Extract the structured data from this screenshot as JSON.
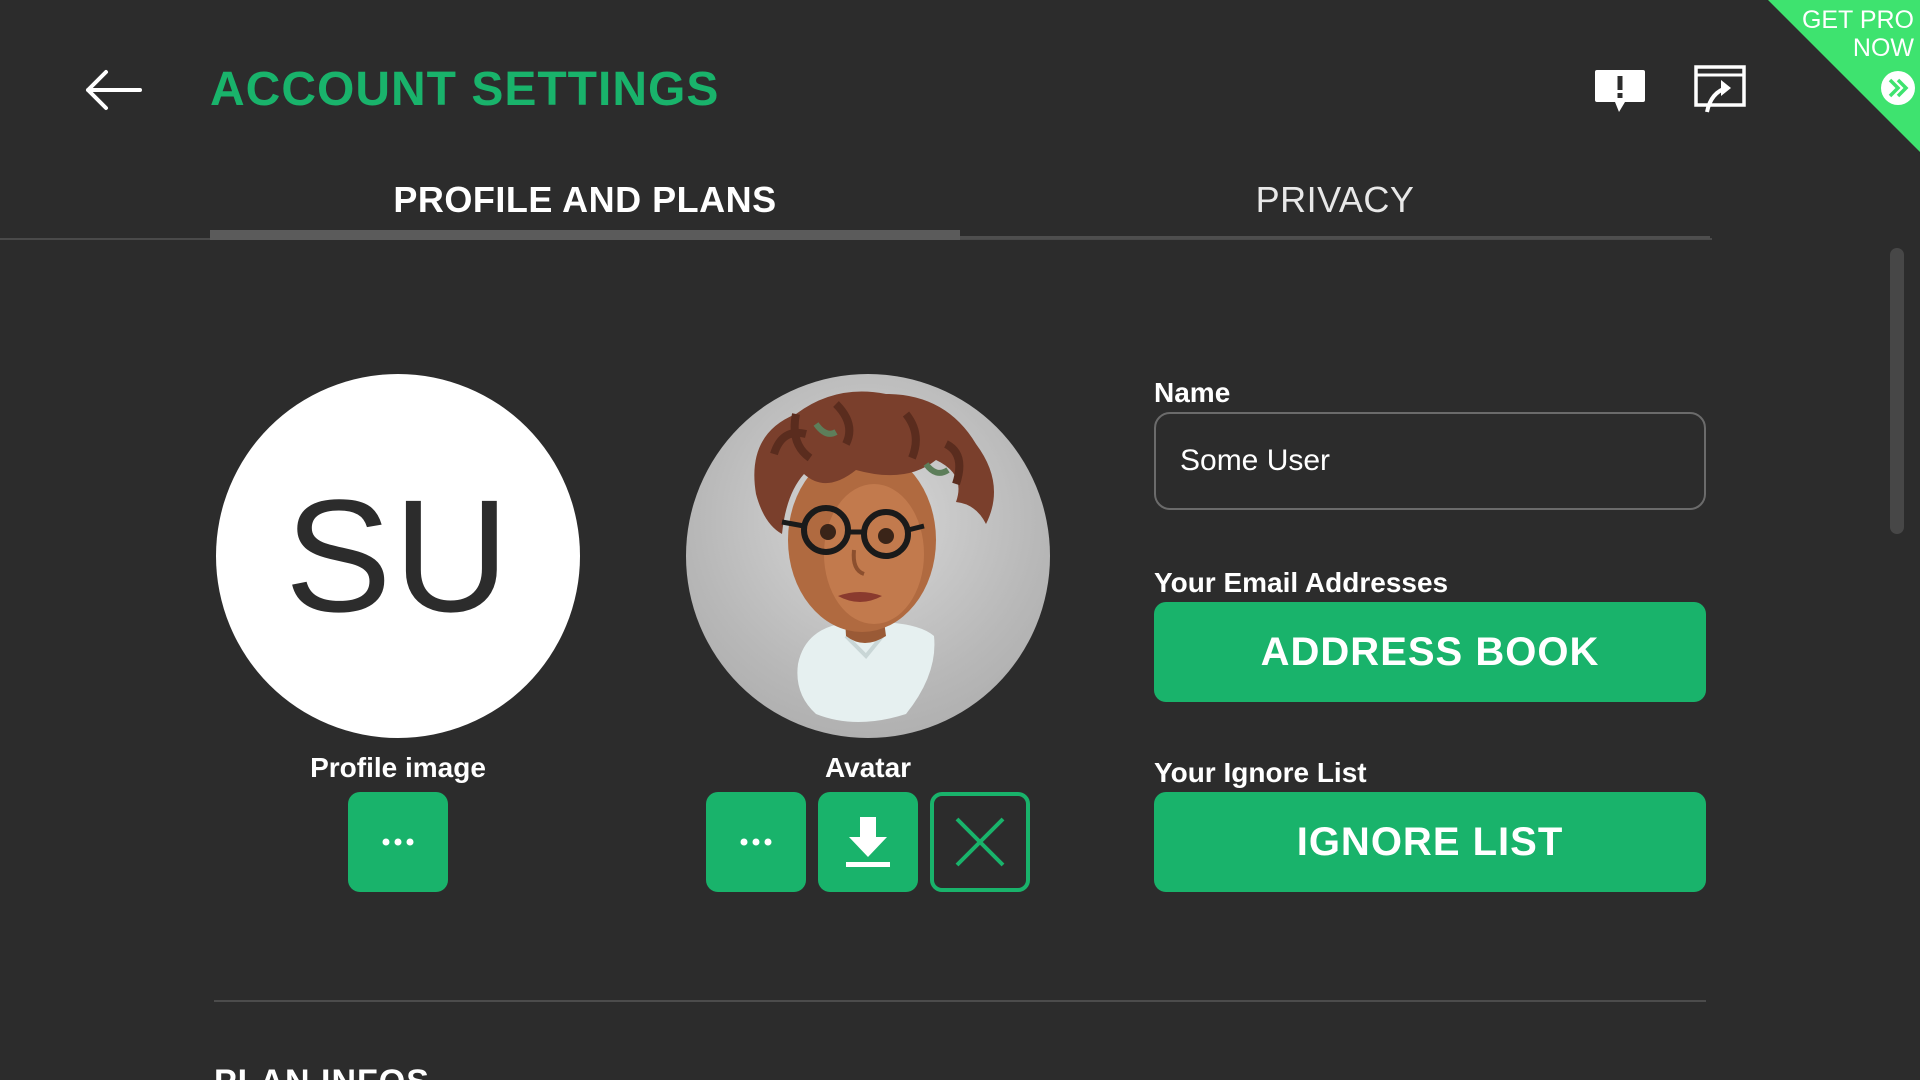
{
  "header": {
    "title": "ACCOUNT SETTINGS",
    "promo_line1": "GET PRO",
    "promo_line2": "NOW"
  },
  "tabs": [
    {
      "label": "PROFILE AND PLANS",
      "active": true
    },
    {
      "label": "PRIVACY",
      "active": false
    }
  ],
  "profile": {
    "initials": "SU",
    "label": "Profile image"
  },
  "avatar": {
    "label": "Avatar"
  },
  "form": {
    "name_label": "Name",
    "name_value": "Some User",
    "email_label": "Your Email Addresses",
    "address_book_button": "ADDRESS BOOK",
    "ignore_label": "Your Ignore List",
    "ignore_button": "IGNORE LIST"
  },
  "section": {
    "heading": "PLAN INFOS"
  },
  "colors": {
    "accent": "#19b36b",
    "promo": "#3ee36f",
    "background": "#2c2c2c"
  },
  "icons": [
    "back-arrow-icon",
    "feedback-icon",
    "share-screen-icon",
    "more-icon",
    "download-icon",
    "close-icon",
    "double-chevron-right-icon"
  ]
}
